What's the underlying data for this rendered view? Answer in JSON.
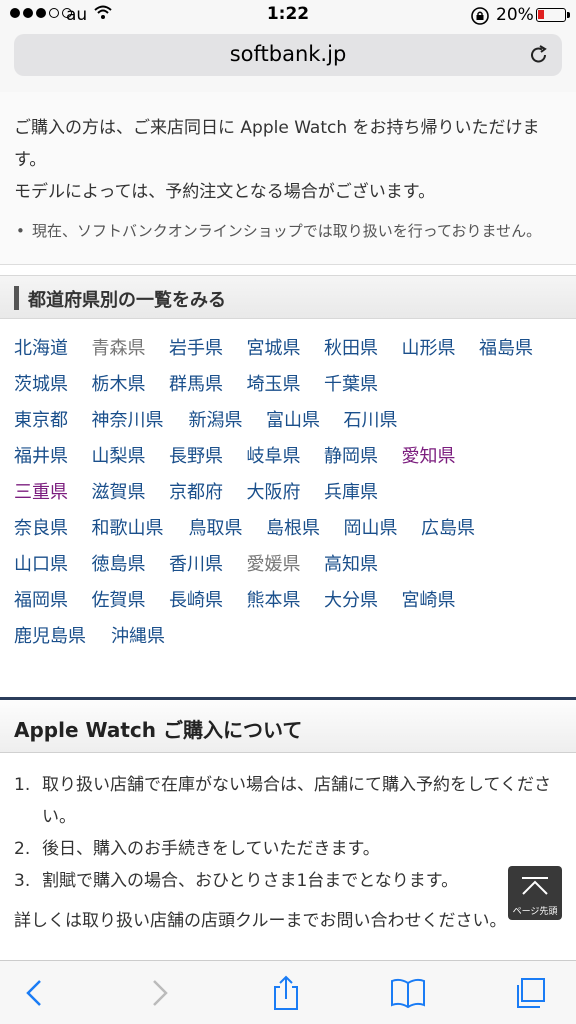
{
  "status": {
    "carrier": "au",
    "time": "1:22",
    "battery": "20%"
  },
  "browser": {
    "url": "softbank.jp"
  },
  "intro": {
    "line1": "ご購入の方は、ご来店同日に Apple Watch をお持ち帰りいただけます。",
    "line2": "モデルによっては、予約注文となる場合がございます。",
    "bullet": "現在、ソフトバンクオンラインショップでは取り扱いを行っておりません。"
  },
  "prefectures": {
    "heading": "都道府県別の一覧をみる",
    "items": [
      {
        "label": "北海道",
        "state": "link"
      },
      {
        "label": "青森県",
        "state": "inactive"
      },
      {
        "label": "岩手県",
        "state": "link"
      },
      {
        "label": "宮城県",
        "state": "link"
      },
      {
        "label": "秋田県",
        "state": "link"
      },
      {
        "label": "山形県",
        "state": "link"
      },
      {
        "label": "福島県",
        "state": "link"
      },
      {
        "label": "茨城県",
        "state": "link"
      },
      {
        "label": "栃木県",
        "state": "link"
      },
      {
        "label": "群馬県",
        "state": "link"
      },
      {
        "label": "埼玉県",
        "state": "link"
      },
      {
        "label": "千葉県",
        "state": "link"
      },
      {
        "label": "東京都",
        "state": "link"
      },
      {
        "label": "神奈川県",
        "state": "link"
      },
      {
        "label": "新潟県",
        "state": "link"
      },
      {
        "label": "富山県",
        "state": "link"
      },
      {
        "label": "石川県",
        "state": "link"
      },
      {
        "label": "福井県",
        "state": "link"
      },
      {
        "label": "山梨県",
        "state": "link"
      },
      {
        "label": "長野県",
        "state": "link"
      },
      {
        "label": "岐阜県",
        "state": "link"
      },
      {
        "label": "静岡県",
        "state": "link"
      },
      {
        "label": "愛知県",
        "state": "visited"
      },
      {
        "label": "三重県",
        "state": "visited"
      },
      {
        "label": "滋賀県",
        "state": "link"
      },
      {
        "label": "京都府",
        "state": "link"
      },
      {
        "label": "大阪府",
        "state": "link"
      },
      {
        "label": "兵庫県",
        "state": "link"
      },
      {
        "label": "奈良県",
        "state": "link"
      },
      {
        "label": "和歌山県",
        "state": "link"
      },
      {
        "label": "鳥取県",
        "state": "link"
      },
      {
        "label": "島根県",
        "state": "link"
      },
      {
        "label": "岡山県",
        "state": "link"
      },
      {
        "label": "広島県",
        "state": "link"
      },
      {
        "label": "山口県",
        "state": "link"
      },
      {
        "label": "徳島県",
        "state": "link"
      },
      {
        "label": "香川県",
        "state": "link"
      },
      {
        "label": "愛媛県",
        "state": "inactive"
      },
      {
        "label": "高知県",
        "state": "link"
      },
      {
        "label": "福岡県",
        "state": "link"
      },
      {
        "label": "佐賀県",
        "state": "link"
      },
      {
        "label": "長崎県",
        "state": "link"
      },
      {
        "label": "熊本県",
        "state": "link"
      },
      {
        "label": "大分県",
        "state": "link"
      },
      {
        "label": "宮崎県",
        "state": "link"
      },
      {
        "label": "鹿児島県",
        "state": "link"
      },
      {
        "label": "沖縄県",
        "state": "link"
      }
    ]
  },
  "purchase": {
    "heading": "Apple Watch ご購入について",
    "steps": [
      {
        "num": "1.",
        "text": "取り扱い店舗で在庫がない場合は、店舗にて購入予約をしてください。"
      },
      {
        "num": "2.",
        "text": "後日、購入のお手続きをしていただきます。"
      },
      {
        "num": "3.",
        "text": "割賦で購入の場合、おひとりさま1台までとなります。"
      }
    ],
    "note": "詳しくは取り扱い店舗の店頭クルーまでお問い合わせください。"
  },
  "scroll_top": {
    "label": "ページ先頭"
  }
}
